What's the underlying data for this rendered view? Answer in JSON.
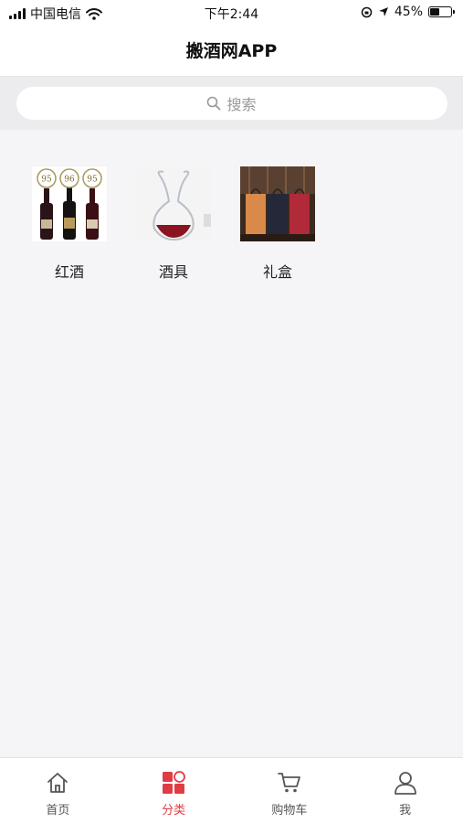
{
  "status_bar": {
    "carrier": "中国电信",
    "time": "下午2:44",
    "battery": "45%",
    "battery_level": 0.45
  },
  "header": {
    "title": "搬酒网APP"
  },
  "search": {
    "placeholder": "搜索",
    "icon": "search-icon"
  },
  "categories": [
    {
      "label": "红酒",
      "image": "red-wine-bottles-image"
    },
    {
      "label": "酒具",
      "image": "decanter-image"
    },
    {
      "label": "礼盒",
      "image": "gift-box-image"
    }
  ],
  "wine_badges": [
    "95",
    "96",
    "95"
  ],
  "tabbar": {
    "active_color": "#e03c43",
    "items": [
      {
        "label": "首页",
        "icon": "home-icon"
      },
      {
        "label": "分类",
        "icon": "category-icon",
        "active": true
      },
      {
        "label": "购物车",
        "icon": "cart-icon"
      },
      {
        "label": "我",
        "icon": "user-icon"
      }
    ]
  }
}
